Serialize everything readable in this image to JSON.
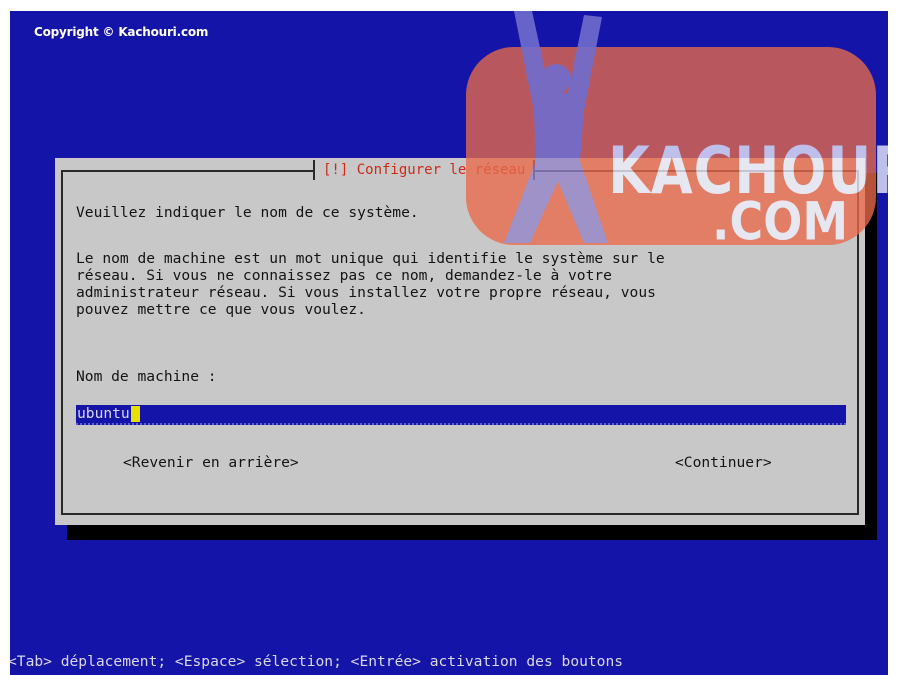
{
  "window": {
    "copyright": "Copyright © Kachouri.com"
  },
  "dialog": {
    "title": "[!] Configurer le réseau",
    "prompt": "Veuillez indiquer le nom de ce système.",
    "description": "Le nom de machine est un mot unique qui identifie le système sur le\nréseau. Si vous ne connaissez pas ce nom, demandez-le à votre\nadministrateur réseau. Si vous installez votre propre réseau, vous\npouvez mettre ce que vous voulez.",
    "field_label": "Nom de machine :",
    "hostname_value": "ubuntu",
    "back_button": "<Revenir en arrière>",
    "continue_button": "<Continuer>"
  },
  "footer": {
    "help": "<Tab> déplacement; <Espace> sélection; <Entrée> activation des boutons"
  },
  "watermark": {
    "brand": "KACHOURI",
    "sub": ".COM"
  },
  "colors": {
    "background": "#1414a8",
    "dialog": "#c8c8c8",
    "title": "#d02818",
    "input": "#1414a8",
    "cursor": "#e8e000",
    "logo": "#e86a4a"
  }
}
